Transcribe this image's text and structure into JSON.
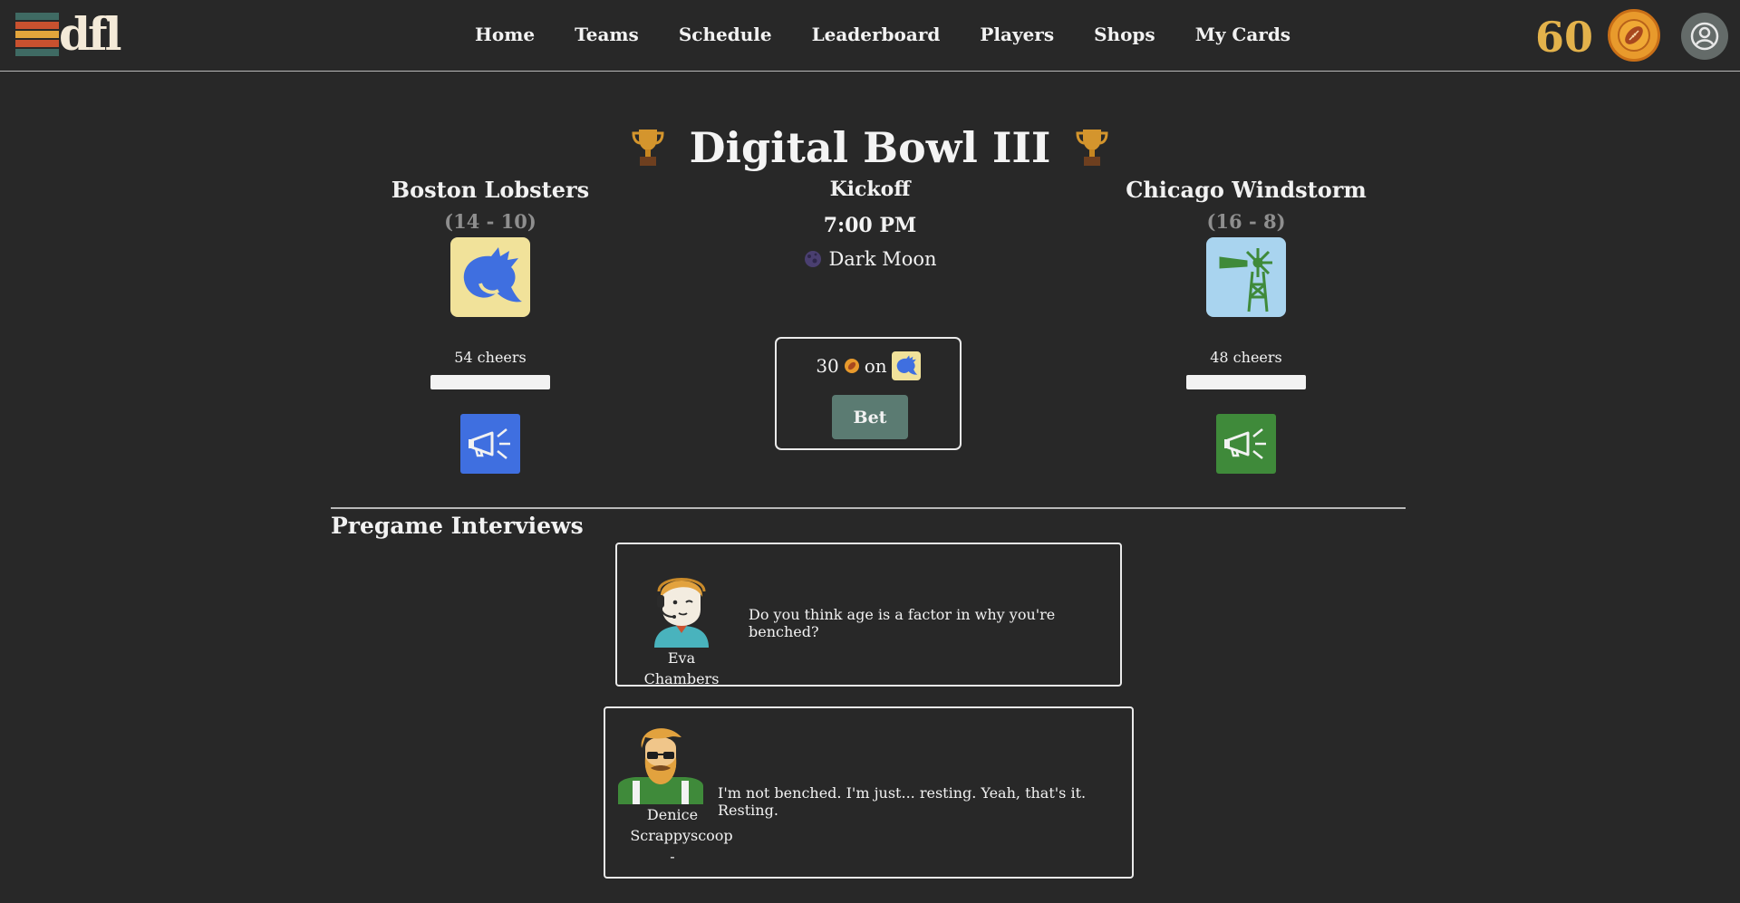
{
  "header": {
    "logo_text": "dfl",
    "nav": [
      "Home",
      "Teams",
      "Schedule",
      "Leaderboard",
      "Players",
      "Shops",
      "My Cards"
    ],
    "coins": "60",
    "colors": {
      "stripe1": "#3f6a63",
      "stripe2": "#c9512f",
      "stripe3": "#e3a53b",
      "coin": "#e3b24b"
    }
  },
  "game": {
    "title": "Digital Bowl III",
    "home": {
      "name": "Boston Lobsters",
      "record": "(14 - 10)",
      "cheers": "54 cheers",
      "color": "#3f6fe0",
      "logo_bg": "#f1e29a"
    },
    "away": {
      "name": "Chicago Windstorm",
      "record": "(16 - 8)",
      "cheers": "48 cheers",
      "color": "#3f8a3a",
      "logo_bg": "#a9d4ef"
    },
    "kickoff_label": "Kickoff",
    "kickoff_time": "7:00 PM",
    "weather": "Dark Moon",
    "bet": {
      "amount": "30",
      "on_label": "on",
      "button": "Bet"
    }
  },
  "interviews": {
    "title": "Pregame Interviews",
    "items": [
      {
        "name": "Eva Chambers",
        "quote": "Do you think age is a factor in why you're benched?"
      },
      {
        "name": "Denice Scrappyscoop",
        "name_line1": "Denice",
        "name_line2": "Scrappyscoop",
        "suffix": "-",
        "quote": "I'm not benched. I'm just... resting. Yeah, that's it. Resting."
      }
    ]
  }
}
